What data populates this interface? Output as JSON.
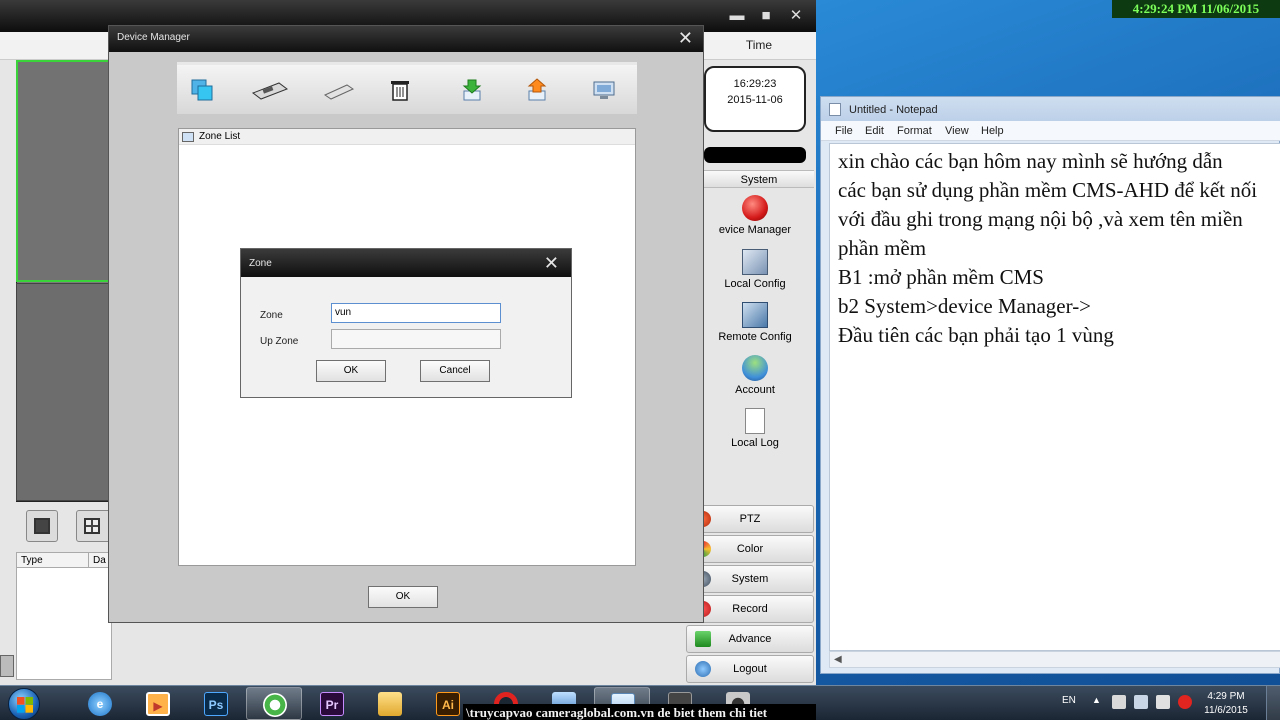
{
  "overlay_clock": "4:29:24 PM 11/06/2015",
  "cms": {
    "controls": {
      "minimize": "▬",
      "maximize": "■",
      "close": "✕"
    },
    "log_table": {
      "columns": [
        "Type",
        "Da"
      ]
    },
    "time_panel": {
      "header": "Time",
      "time": "16:29:23",
      "date": "2015-11-06"
    },
    "system_panel": {
      "header": "System",
      "items": [
        "evice Manager",
        "Local Config",
        "Remote Config",
        "Account",
        "Local Log"
      ]
    },
    "menu_buttons": [
      "PTZ",
      "Color",
      "System",
      "Record",
      "Advance",
      "Logout"
    ]
  },
  "device_manager": {
    "title": "Device Manager",
    "close": "✕",
    "toolbar_icons": [
      "add-zone-icon",
      "add-device-icon",
      "edit-icon",
      "delete-icon",
      "import-icon",
      "export-icon",
      "network-device-icon"
    ],
    "zone_list_label": "Zone List",
    "ok_label": "OK"
  },
  "zone_dialog": {
    "title": "Zone",
    "close": "✕",
    "zone_label": "Zone",
    "zone_value": "vun",
    "up_zone_label": "Up Zone",
    "up_zone_value": "",
    "ok_label": "OK",
    "cancel_label": "Cancel"
  },
  "notepad": {
    "title": "Untitled - Notepad",
    "menu": [
      "File",
      "Edit",
      "Format",
      "View",
      "Help"
    ],
    "lines": [
      "xin chào các bạn hôm nay mình sẽ hướng dẫn",
      "các bạn sử dụng phần mềm CMS-AHD để kết nối",
      "với đầu ghi trong mạng nội bộ ,và xem tên miền",
      "phần mềm",
      "B1 :mở phần mềm CMS",
      "b2 System>device Manager->",
      "Đầu tiên các bạn phải tạo 1 vùng"
    ]
  },
  "taskbar": {
    "apps": [
      "ie-icon",
      "media-player-icon",
      "photoshop-icon",
      "camera-cms-icon",
      "premiere-icon",
      "file-explorer-icon",
      "illustrator-icon",
      "opera-icon",
      "network-icon",
      "notepad-icon",
      "video-tool-icon",
      "camera-icon"
    ],
    "labels": {
      "photoshop": "Ps",
      "premiere": "Pr",
      "illustrator": "Ai"
    },
    "banner": "\\truycapvao cameraglobal.com.vn de biet them chi tiet",
    "tray_lang": "EN",
    "tray_arrow": "▲",
    "tray_time": "4:29 PM",
    "tray_date": "11/6/2015"
  },
  "colors": {
    "overlay_text": "#7cff5a",
    "video_selected_border": "#3ad43a"
  }
}
